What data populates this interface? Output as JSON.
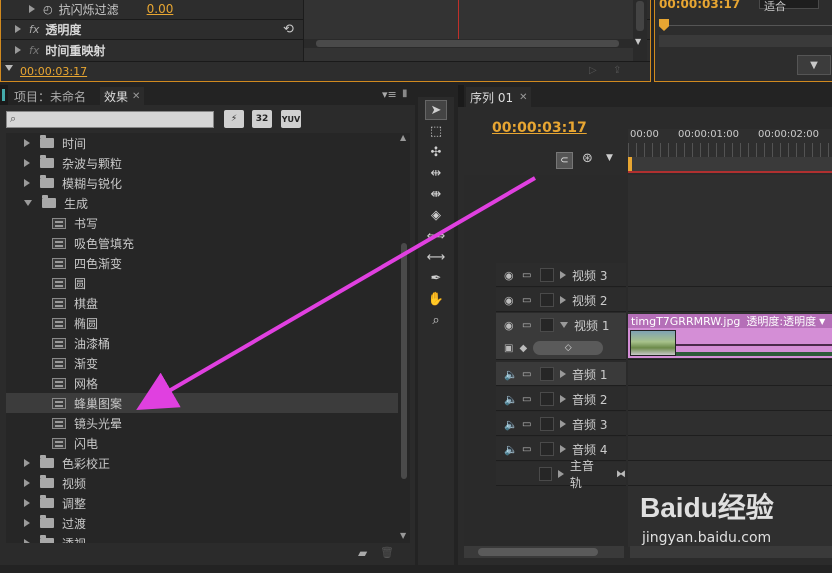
{
  "effect_controls": {
    "rows": [
      {
        "label": "抗闪烁过滤",
        "value": "0.00"
      },
      {
        "label": "透明度"
      },
      {
        "label": "时间重映射"
      }
    ],
    "timecode": "00:00:03:17"
  },
  "program_monitor": {
    "timecode": "00:00:03:17",
    "fit_label": "适合"
  },
  "effects_panel": {
    "tabs": [
      {
        "label": "项目：未命名"
      },
      {
        "label": "效果"
      }
    ],
    "buttons": [
      "32",
      "YUV"
    ],
    "tree": [
      {
        "label": "时间",
        "type": "folder"
      },
      {
        "label": "杂波与颗粒",
        "type": "folder"
      },
      {
        "label": "模糊与锐化",
        "type": "folder"
      },
      {
        "label": "生成",
        "type": "folder-open"
      },
      {
        "label": "书写",
        "type": "effect"
      },
      {
        "label": "吸色管填充",
        "type": "effect"
      },
      {
        "label": "四色渐变",
        "type": "effect"
      },
      {
        "label": "圆",
        "type": "effect"
      },
      {
        "label": "棋盘",
        "type": "effect"
      },
      {
        "label": "椭圆",
        "type": "effect"
      },
      {
        "label": "油漆桶",
        "type": "effect"
      },
      {
        "label": "渐变",
        "type": "effect"
      },
      {
        "label": "网格",
        "type": "effect"
      },
      {
        "label": "蜂巢图案",
        "type": "effect",
        "selected": true
      },
      {
        "label": "镜头光晕",
        "type": "effect"
      },
      {
        "label": "闪电",
        "type": "effect"
      },
      {
        "label": "色彩校正",
        "type": "folder"
      },
      {
        "label": "视频",
        "type": "folder"
      },
      {
        "label": "调整",
        "type": "folder"
      },
      {
        "label": "过渡",
        "type": "folder"
      },
      {
        "label": "透视",
        "type": "folder"
      }
    ]
  },
  "timeline": {
    "tab_label": "序列 01",
    "timecode": "00:00:03:17",
    "ruler": [
      "00:00",
      "00:00:01:00",
      "00:00:02:00"
    ],
    "tracks": [
      {
        "label": "视频 3",
        "kind": "video"
      },
      {
        "label": "视频 2",
        "kind": "video"
      },
      {
        "label": "视频 1",
        "kind": "video"
      },
      {
        "label": "音频 1",
        "kind": "audio"
      },
      {
        "label": "音频 2",
        "kind": "audio"
      },
      {
        "label": "音频 3",
        "kind": "audio"
      },
      {
        "label": "音频 4",
        "kind": "audio"
      },
      {
        "label": "主音轨",
        "kind": "master"
      }
    ],
    "clip": {
      "name": "timgT7GRRMRW.jpg",
      "effect_label": "透明度:透明度"
    }
  },
  "watermark": {
    "logo": "Baidu经验",
    "url": "jingyan.baidu.com"
  },
  "colors": {
    "accent": "#e8a632",
    "clip": "#d48ed6",
    "arrow": "#e040e0",
    "bg": "#2d2d2d"
  }
}
